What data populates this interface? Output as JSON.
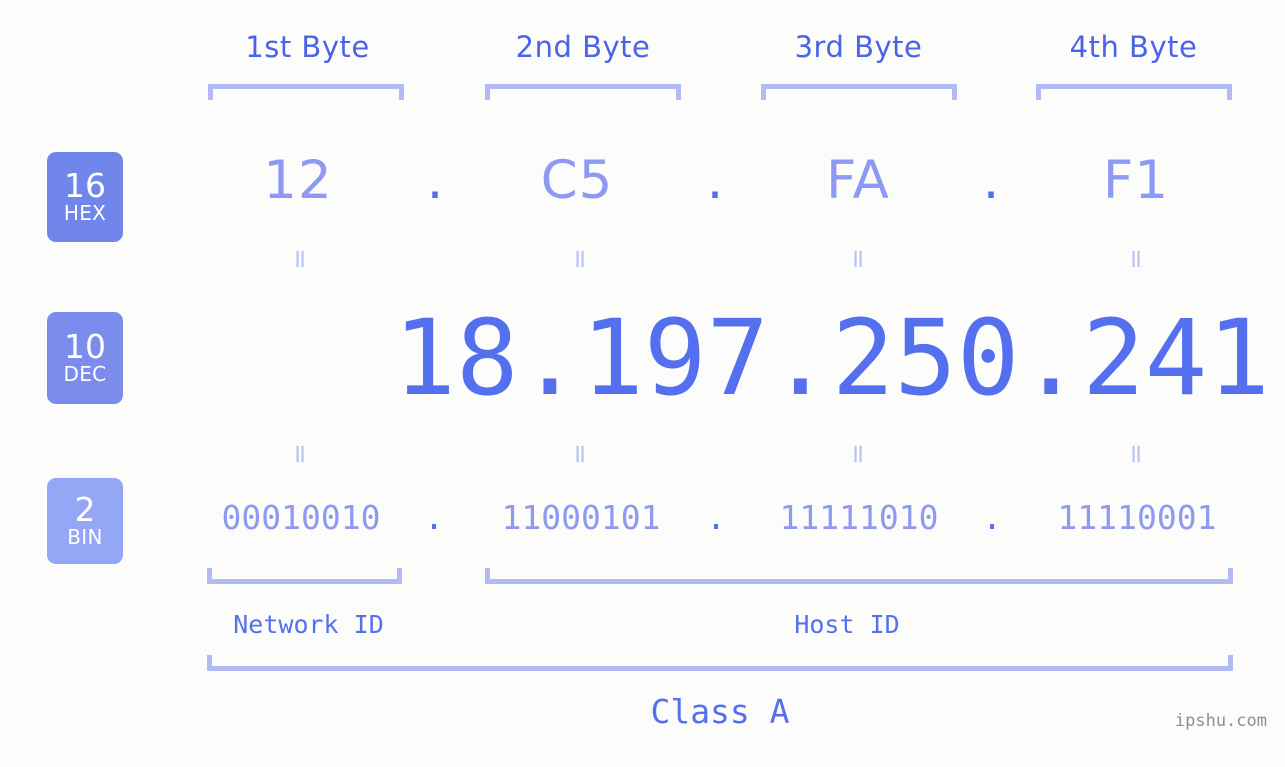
{
  "ip": {
    "decimal": "18.197.250.241",
    "class": "Class A",
    "class_label": "Class A"
  },
  "columns": [
    {
      "header": "1st Byte",
      "hex": "12",
      "dec": "18",
      "bin": "00010010"
    },
    {
      "header": "2nd Byte",
      "hex": "C5",
      "dec": "197",
      "bin": "11000101"
    },
    {
      "header": "3rd Byte",
      "hex": "FA",
      "dec": "250",
      "bin": "11111010"
    },
    {
      "header": "4th Byte",
      "hex": "F1",
      "dec": "241",
      "bin": "11110001"
    }
  ],
  "separators": {
    "dot": ".",
    "equals": "="
  },
  "bases": [
    {
      "num": "16",
      "name": "HEX",
      "color": "#7086ea"
    },
    {
      "num": "10",
      "name": "DEC",
      "color": "#7b8ced"
    },
    {
      "num": "2",
      "name": "BIN",
      "color": "#94a6f6"
    }
  ],
  "regions": {
    "network_id": "Network ID",
    "host_id": "Host ID"
  },
  "watermark": "ipshu.com",
  "colors": {
    "background": "#fcfdfa",
    "accent_strong": "#5570ef",
    "accent_header": "#4a63e7",
    "accent_light": "#8d99f2",
    "bracket": "#b3bbf7",
    "equals": "#b9c0f8",
    "watermark": "#8d8f94"
  }
}
